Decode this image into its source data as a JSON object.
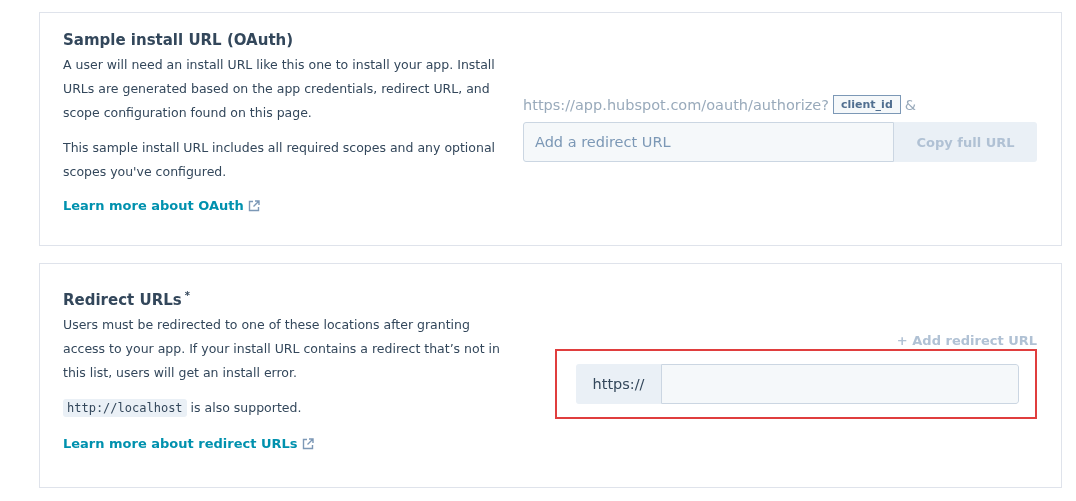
{
  "install_url": {
    "title": "Sample install URL (OAuth)",
    "paragraphs": [
      "A user will need an install URL like this one to install your app. Install URLs are generated based on the app credentials, redirect URL, and scope configuration found on this page.",
      "This sample install URL includes all required scopes and any optional scopes you've configured."
    ],
    "link": "Learn more about OAuth",
    "url_prefix": "https://app.hubspot.com/oauth/authorize?",
    "param_tag": "client_id",
    "url_suffix": "&",
    "redirect_field": {
      "placeholder": "Add a redirect URL"
    },
    "copy_button": {
      "label": "Copy full URL",
      "disabled": true
    }
  },
  "redirect_urls": {
    "title": "Redirect URLs",
    "required_mark": "*",
    "paragraph": "Users must be redirected to one of these locations after granting access to your app. If your install URL contains a redirect that’s not in this list, users will get an install error.",
    "localhost_code": "http://localhost",
    "localhost_note": "is also supported.",
    "link": "Learn more about redirect URLs",
    "add_button": {
      "label": "+ Add redirect URL",
      "disabled": true
    },
    "url_field": {
      "prefix": "https://",
      "highlighted": true
    }
  }
}
